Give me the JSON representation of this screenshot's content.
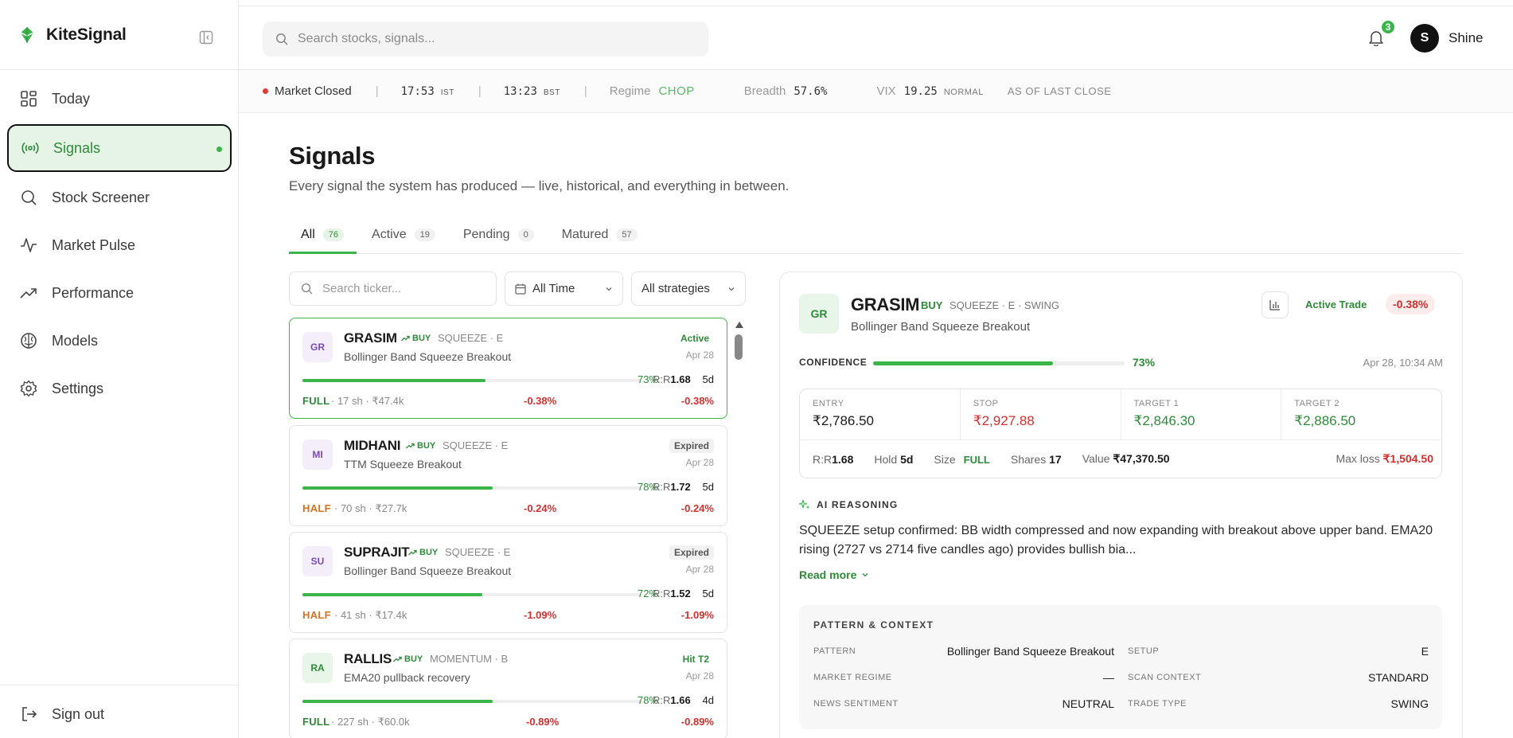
{
  "app": {
    "name": "KiteSignal"
  },
  "sidebar": {
    "items": [
      {
        "label": "Today",
        "icon": "grid-icon"
      },
      {
        "label": "Signals",
        "icon": "broadcast-icon",
        "active": true
      },
      {
        "label": "Stock Screener",
        "icon": "search-icon"
      },
      {
        "label": "Market Pulse",
        "icon": "pulse-icon"
      },
      {
        "label": "Performance",
        "icon": "trending-up-icon"
      },
      {
        "label": "Models",
        "icon": "brain-icon"
      },
      {
        "label": "Settings",
        "icon": "gear-icon"
      }
    ],
    "signout": "Sign out"
  },
  "header": {
    "search_placeholder": "Search stocks, signals...",
    "notifications": "3",
    "user_initial": "S",
    "user_name": "Shine"
  },
  "market": {
    "status": "Market Closed",
    "ist_time": "17:53",
    "ist_label": "IST",
    "bst_time": "13:23",
    "bst_label": "BST",
    "regime_label": "Regime",
    "regime_value": "CHOP",
    "breadth_label": "Breadth",
    "breadth_value": "57.6%",
    "vix_label": "VIX",
    "vix_value": "19.25",
    "vix_state": "NORMAL",
    "as_of": "AS OF LAST CLOSE"
  },
  "page": {
    "title": "Signals",
    "subtitle": "Every signal the system has produced — live, historical, and everything in between."
  },
  "tabs": [
    {
      "label": "All",
      "count": "76"
    },
    {
      "label": "Active",
      "count": "19"
    },
    {
      "label": "Pending",
      "count": "0"
    },
    {
      "label": "Matured",
      "count": "57"
    }
  ],
  "filters": {
    "ticker_placeholder": "Search ticker...",
    "time": "All Time",
    "strategy": "All strategies"
  },
  "signals": [
    {
      "initials": "GR",
      "ticker": "GRASIM",
      "side": "BUY",
      "strategy": "SQUEEZE · E",
      "desc": "Bollinger Band Squeeze Breakout",
      "status": "Active",
      "date": "Apr 28",
      "confidence": 73,
      "pct": "73%",
      "rr": "1.68",
      "hold": "5d",
      "size": "FULL",
      "shares": "17 sh",
      "value": "₹47.4k",
      "pnl": "-0.38%",
      "pnl2": "-0.38%"
    },
    {
      "initials": "MI",
      "ticker": "MIDHANI",
      "side": "BUY",
      "strategy": "SQUEEZE · E",
      "desc": "TTM Squeeze Breakout",
      "status": "Expired",
      "date": "Apr 28",
      "confidence": 78,
      "pct": "78%",
      "rr": "1.72",
      "hold": "5d",
      "size": "HALF",
      "shares": "70 sh",
      "value": "₹27.7k",
      "pnl": "-0.24%",
      "pnl2": "-0.24%"
    },
    {
      "initials": "SU",
      "ticker": "SUPRAJIT",
      "side": "BUY",
      "strategy": "SQUEEZE · E",
      "desc": "Bollinger Band Squeeze Breakout",
      "status": "Expired",
      "date": "Apr 28",
      "confidence": 72,
      "pct": "72%",
      "rr": "1.52",
      "hold": "5d",
      "size": "HALF",
      "shares": "41 sh",
      "value": "₹17.4k",
      "pnl": "-1.09%",
      "pnl2": "-1.09%"
    },
    {
      "initials": "RA",
      "ticker": "RALLIS",
      "side": "BUY",
      "strategy": "MOMENTUM · B",
      "desc": "EMA20 pullback recovery",
      "status": "Hit T2",
      "date": "Apr 28",
      "confidence": 78,
      "pct": "78%",
      "rr": "1.66",
      "hold": "4d",
      "size": "FULL",
      "shares": "227 sh",
      "value": "₹60.0k",
      "pnl": "-0.89%",
      "pnl2": "-0.89%"
    }
  ],
  "detail": {
    "initials": "GR",
    "ticker": "GRASIM",
    "side": "BUY",
    "strategy": "SQUEEZE · E · SWING",
    "desc": "Bollinger Band Squeeze Breakout",
    "status": "Active Trade",
    "pnl": "-0.38%",
    "confidence_label": "CONFIDENCE",
    "confidence": 73,
    "confidence_pct": "73%",
    "timestamp": "Apr 28, 10:34 AM",
    "levels": [
      {
        "label": "ENTRY",
        "value": "₹2,786.50"
      },
      {
        "label": "STOP",
        "value": "₹2,927.88"
      },
      {
        "label": "TARGET 1",
        "value": "₹2,846.30"
      },
      {
        "label": "TARGET 2",
        "value": "₹2,886.50"
      }
    ],
    "meta": {
      "rr_label": "R:R",
      "rr": "1.68",
      "hold_label": "Hold",
      "hold": "5d",
      "size_label": "Size",
      "size": "FULL",
      "shares_label": "Shares",
      "shares": "17",
      "value_label": "Value",
      "value": "₹47,370.50",
      "maxloss_label": "Max loss",
      "maxloss": "₹1,504.50"
    },
    "ai_label": "AI REASONING",
    "ai_text": "SQUEEZE setup confirmed: BB width compressed and now expanding with breakout above upper band. EMA20 rising (2727 vs 2714 five candles ago) provides bullish bia...",
    "read_more": "Read more",
    "context_title": "PATTERN & CONTEXT",
    "context": [
      {
        "k": "PATTERN",
        "v": "Bollinger Band Squeeze Breakout"
      },
      {
        "k": "SETUP",
        "v": "E"
      },
      {
        "k": "MARKET REGIME",
        "v": "—"
      },
      {
        "k": "SCAN CONTEXT",
        "v": "STANDARD"
      },
      {
        "k": "NEWS SENTIMENT",
        "v": "NEUTRAL"
      },
      {
        "k": "TRADE TYPE",
        "v": "SWING"
      }
    ]
  },
  "colors": {
    "accent": "#3bb54a",
    "accent_dark": "#2e8a3a",
    "negative": "#d32f2f",
    "half": "#d1721c"
  }
}
